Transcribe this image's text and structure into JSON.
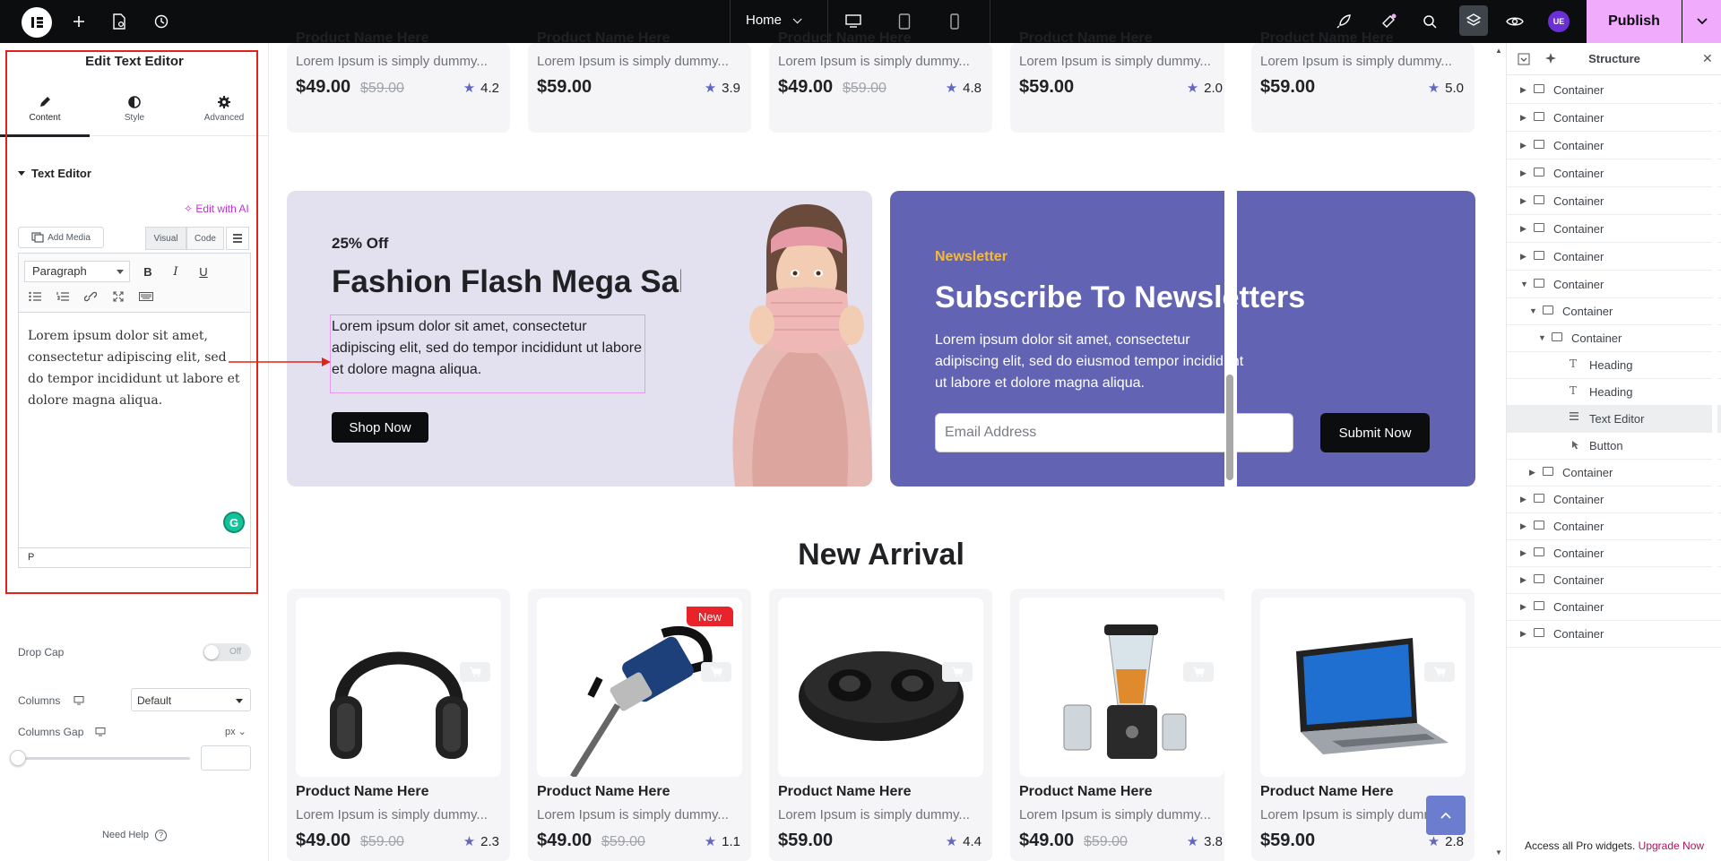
{
  "topbar": {
    "page_name": "Home",
    "publish_label": "Publish",
    "avatar_initials": "UE",
    "accent_color": "#f0abfc"
  },
  "left_panel": {
    "title": "Edit Text Editor",
    "tabs": [
      {
        "label": "Content",
        "icon": "pencil-icon"
      },
      {
        "label": "Style",
        "icon": "half-circle-icon"
      },
      {
        "label": "Advanced",
        "icon": "gear-icon"
      }
    ],
    "section_title": "Text Editor",
    "edit_ai_label": "Edit with AI",
    "add_media_label": "Add Media",
    "visual_tab": "Visual",
    "code_tab": "Code",
    "format_select": "Paragraph",
    "editor_text": "Lorem ipsum dolor sit amet, consectetur adipiscing elit, sed do tempor incididunt ut labore et dolore magna aliqua.",
    "editor_status": "P",
    "drop_cap_label": "Drop Cap",
    "drop_cap_value": "Off",
    "columns_label": "Columns",
    "columns_value": "Default",
    "columns_gap_label": "Columns Gap",
    "columns_gap_unit": "px",
    "help_label": "Need Help"
  },
  "canvas": {
    "top_products": [
      {
        "name": "Product Name Here",
        "desc": "Lorem Ipsum is simply dummy...",
        "price": "$49.00",
        "old_price": "$59.00",
        "rating": "4.2"
      },
      {
        "name": "Product Name Here",
        "desc": "Lorem Ipsum is simply dummy...",
        "price": "$59.00",
        "old_price": "",
        "rating": "3.9"
      },
      {
        "name": "Product Name Here",
        "desc": "Lorem Ipsum is simply dummy...",
        "price": "$49.00",
        "old_price": "$59.00",
        "rating": "4.8"
      },
      {
        "name": "Product Name Here",
        "desc": "Lorem Ipsum is simply dummy...",
        "price": "$59.00",
        "old_price": "",
        "rating": "2.0"
      },
      {
        "name": "Product Name Here",
        "desc": "Lorem Ipsum is simply dummy...",
        "price": "$59.00",
        "old_price": "",
        "rating": "5.0"
      }
    ],
    "promo": {
      "discount": "25% Off",
      "heading": "Fashion Flash Mega Sale",
      "text": "Lorem ipsum dolor sit amet, consectetur adipiscing elit, sed do tempor incididunt ut labore et dolore magna aliqua.",
      "button": "Shop Now"
    },
    "newsletter": {
      "label": "Newsletter",
      "heading": "Subscribe To Newsletters",
      "text": "Lorem ipsum dolor sit amet, consectetur adipiscing elit, sed do eiusmod tempor incididunt ut labore et dolore magna aliqua.",
      "email_placeholder": "Email Address",
      "button": "Submit Now"
    },
    "new_arrival_title": "New Arrival",
    "new_badge": "New",
    "new_products": [
      {
        "name": "Product Name Here",
        "desc": "Lorem Ipsum is simply dummy...",
        "price": "$49.00",
        "old_price": "$59.00",
        "rating": "2.3",
        "image": "headphones-image"
      },
      {
        "name": "Product Name Here",
        "desc": "Lorem Ipsum is simply dummy...",
        "price": "$49.00",
        "old_price": "$59.00",
        "rating": "1.1",
        "image": "jackhammer-image"
      },
      {
        "name": "Product Name Here",
        "desc": "Lorem Ipsum is simply dummy...",
        "price": "$59.00",
        "old_price": "",
        "rating": "4.4",
        "image": "earbuds-case-image"
      },
      {
        "name": "Product Name Here",
        "desc": "Lorem Ipsum is simply dummy...",
        "price": "$49.00",
        "old_price": "$59.00",
        "rating": "3.8",
        "image": "blender-image"
      },
      {
        "name": "Product Name Here",
        "desc": "Lorem Ipsum is simply dumm",
        "price": "$59.00",
        "old_price": "",
        "rating": "2.8",
        "image": "laptop-image"
      }
    ]
  },
  "structure": {
    "title": "Structure",
    "items": [
      {
        "label": "Container",
        "level": 0,
        "expanded": false,
        "type": "container"
      },
      {
        "label": "Container",
        "level": 0,
        "expanded": false,
        "type": "container"
      },
      {
        "label": "Container",
        "level": 0,
        "expanded": false,
        "type": "container"
      },
      {
        "label": "Container",
        "level": 0,
        "expanded": false,
        "type": "container"
      },
      {
        "label": "Container",
        "level": 0,
        "expanded": false,
        "type": "container"
      },
      {
        "label": "Container",
        "level": 0,
        "expanded": false,
        "type": "container"
      },
      {
        "label": "Container",
        "level": 0,
        "expanded": false,
        "type": "container"
      },
      {
        "label": "Container",
        "level": 0,
        "expanded": true,
        "type": "container"
      },
      {
        "label": "Container",
        "level": 1,
        "expanded": true,
        "type": "container"
      },
      {
        "label": "Container",
        "level": 2,
        "expanded": true,
        "type": "container"
      },
      {
        "label": "Heading",
        "level": 3,
        "type": "heading"
      },
      {
        "label": "Heading",
        "level": 3,
        "type": "heading"
      },
      {
        "label": "Text Editor",
        "level": 3,
        "type": "text",
        "selected": true
      },
      {
        "label": "Button",
        "level": 3,
        "type": "button"
      },
      {
        "label": "Container",
        "level": 1,
        "expanded": false,
        "type": "container"
      },
      {
        "label": "Container",
        "level": 0,
        "expanded": false,
        "type": "container"
      },
      {
        "label": "Container",
        "level": 0,
        "expanded": false,
        "type": "container"
      },
      {
        "label": "Container",
        "level": 0,
        "expanded": false,
        "type": "container"
      },
      {
        "label": "Container",
        "level": 0,
        "expanded": false,
        "type": "container"
      },
      {
        "label": "Container",
        "level": 0,
        "expanded": false,
        "type": "container"
      },
      {
        "label": "Container",
        "level": 0,
        "expanded": false,
        "type": "container"
      }
    ],
    "footer_text": "Access all Pro widgets.",
    "footer_link": "Upgrade Now"
  }
}
